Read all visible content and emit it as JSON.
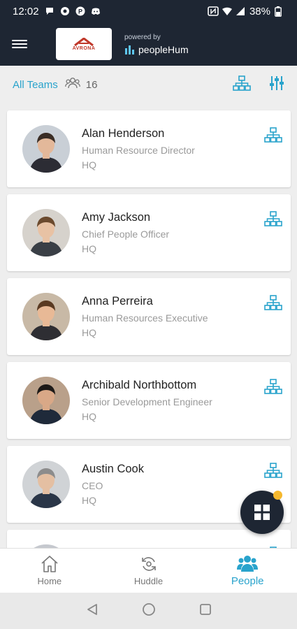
{
  "status_bar": {
    "time": "12:02",
    "battery": "38%",
    "icons": [
      "message-icon",
      "record-icon",
      "p-icon",
      "discord-icon",
      "nfc-icon",
      "wifi-icon",
      "signal-icon",
      "battery-icon"
    ]
  },
  "header": {
    "logo_text": "AVRONA",
    "powered_by": "powered by",
    "brand": "peopleHum",
    "icons": [
      "menu-icon"
    ]
  },
  "teams_bar": {
    "all_teams": "All Teams",
    "count": "16",
    "icons": [
      "team-icon",
      "org-chart-icon",
      "filter-icon"
    ]
  },
  "people": [
    {
      "name": "Alan Henderson",
      "title": "Human Resource Director",
      "location": "HQ",
      "avatar_bg": "#c9cfd6",
      "hair": "#3a2d25",
      "skin": "#e3b89a",
      "shirt": "#2c2c34"
    },
    {
      "name": "Amy Jackson",
      "title": "Chief People Officer",
      "location": "HQ",
      "avatar_bg": "#d6d2cc",
      "hair": "#6b4a2e",
      "skin": "#e8c2a4",
      "shirt": "#3a3f46"
    },
    {
      "name": "Anna Perreira",
      "title": "Human Resources Executive",
      "location": "HQ",
      "avatar_bg": "#c8b9a6",
      "hair": "#5a3a22",
      "skin": "#e8b996",
      "shirt": "#2e2e33"
    },
    {
      "name": "Archibald Northbottom",
      "title": "Senior Development Engineer",
      "location": "HQ",
      "avatar_bg": "#b9a08a",
      "hair": "#1d1a18",
      "skin": "#d9a887",
      "shirt": "#1f2a3a"
    },
    {
      "name": "Austin Cook",
      "title": "CEO",
      "location": "HQ",
      "avatar_bg": "#d0d3d6",
      "hair": "#8c8c8c",
      "skin": "#e4bfa2",
      "shirt": "#2a3648"
    },
    {
      "name": "",
      "title": "",
      "location": "",
      "avatar_bg": "#c5c8ce",
      "hair": "#2a2a3a",
      "skin": "#e0b898",
      "shirt": "#2a2a2a"
    }
  ],
  "fab": {
    "icon": "apps-grid-icon",
    "badge_color": "#f5b82e"
  },
  "bottom_nav": [
    {
      "label": "Home",
      "icon": "home-icon",
      "active": false
    },
    {
      "label": "Huddle",
      "icon": "huddle-icon",
      "active": false
    },
    {
      "label": "People",
      "icon": "people-icon",
      "active": true
    }
  ],
  "system_nav": {
    "icons": [
      "back-icon",
      "home-circle-icon",
      "recents-icon"
    ]
  },
  "colors": {
    "header_bg": "#1e2633",
    "accent": "#29a3cc",
    "card_bg": "#ffffff",
    "page_bg": "#eeeeee"
  }
}
